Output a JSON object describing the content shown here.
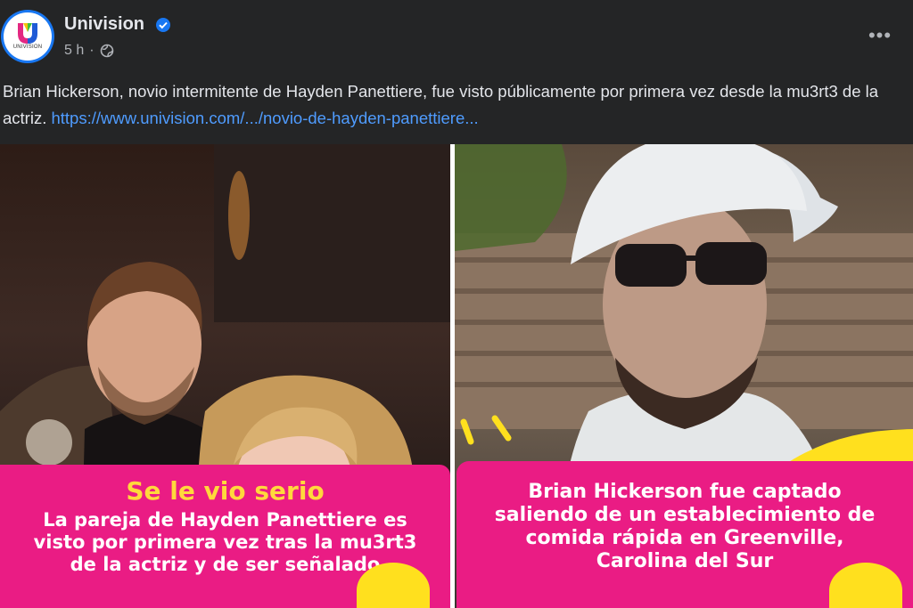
{
  "post": {
    "page_name": "Univision",
    "avatar_wordmark": "UNIVISION",
    "time": "5 h",
    "more_label": "•••",
    "text": "Brian Hickerson, novio intermitente de Hayden Panettiere, fue visto públicamente por primera vez desde la mu3rt3 de la actriz.",
    "link_text": "https://www.univision.com/.../novio-de-hayden-panettiere..."
  },
  "media": {
    "left": {
      "title": "Se le vio serio",
      "body": "La pareja de Hayden Panettiere es visto por primera vez tras la mu3rt3 de la actriz y de ser señalado"
    },
    "right": {
      "body": "Brian Hickerson fue captado saliendo de un establecimiento de comida rápida en Greenville, Carolina del Sur"
    }
  },
  "colors": {
    "background": "#242526",
    "link": "#4f9cff",
    "verified": "#1877f2",
    "caption_pink": "#ea1c84",
    "caption_yellow": "#ffd83c"
  },
  "icons": [
    "univision-logo-icon",
    "verified-badge-icon",
    "globe-icon",
    "more-options-icon"
  ]
}
